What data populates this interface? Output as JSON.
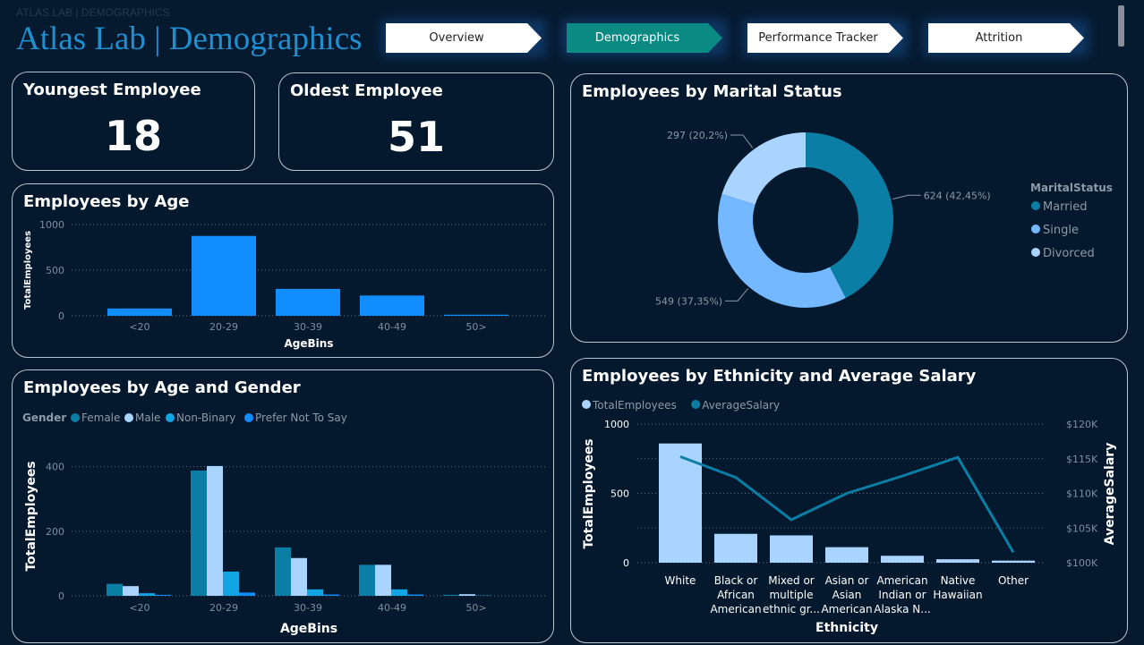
{
  "header": {
    "small_title": "ATLAS LAB | DEMOGRAPHICS",
    "title": "Atlas Lab | Demographics"
  },
  "nav": [
    {
      "label": "Overview",
      "active": false
    },
    {
      "label": "Demographics",
      "active": true
    },
    {
      "label": "Performance Tracker",
      "active": false
    },
    {
      "label": "Attrition",
      "active": false
    }
  ],
  "kpis": {
    "youngest": {
      "label": "Youngest Employee",
      "value": "18"
    },
    "oldest": {
      "label": "Oldest Employee",
      "value": "51"
    }
  },
  "colors": {
    "bright_blue": "#118dff",
    "teal": "#0a7ea4",
    "light_blue": "#a8d4ff",
    "cyan": "#12a5e4",
    "mid_blue": "#74b9ff",
    "background": "#061a2f"
  },
  "chart_data": [
    {
      "id": "age",
      "type": "bar",
      "title": "Employees by Age",
      "xlabel": "AgeBins",
      "ylabel": "TotalEmployees",
      "categories": [
        "<20",
        "20-29",
        "30-39",
        "40-49",
        "50>"
      ],
      "values": [
        80,
        875,
        295,
        222,
        12
      ],
      "ylim": [
        0,
        1000
      ],
      "yticks": [
        0,
        500,
        1000
      ],
      "grid": true
    },
    {
      "id": "age_gender",
      "type": "bar",
      "title": "Employees by Age and Gender",
      "xlabel": "AgeBins",
      "ylabel": "TotalEmployees",
      "legend_title": "Gender",
      "legend_position": "top-left",
      "categories": [
        "<20",
        "20-29",
        "30-39",
        "40-49",
        "50>"
      ],
      "series": [
        {
          "name": "Female",
          "color": "#0a7ea4",
          "values": [
            37,
            388,
            150,
            96,
            3
          ]
        },
        {
          "name": "Male",
          "color": "#a8d4ff",
          "values": [
            30,
            402,
            117,
            96,
            5
          ]
        },
        {
          "name": "Non-Binary",
          "color": "#12a5e4",
          "values": [
            8,
            75,
            20,
            20,
            1
          ]
        },
        {
          "name": "Prefer Not To Say",
          "color": "#118dff",
          "values": [
            3,
            10,
            4,
            4,
            0
          ]
        }
      ],
      "ylim": [
        0,
        460
      ],
      "yticks": [
        0,
        200,
        400
      ],
      "grid": true
    },
    {
      "id": "marital",
      "type": "pie",
      "title": "Employees by Marital Status",
      "legend_title": "MaritalStatus",
      "legend_position": "right",
      "slices": [
        {
          "name": "Married",
          "value": 624,
          "label": "624 (42,45%)",
          "color": "#0a7ea4"
        },
        {
          "name": "Single",
          "value": 549,
          "label": "549 (37,35%)",
          "color": "#74b9ff"
        },
        {
          "name": "Divorced",
          "value": 297,
          "label": "297 (20,2%)",
          "color": "#a8d4ff"
        }
      ]
    },
    {
      "id": "ethnicity",
      "type": "bar",
      "title": "Employees by Ethnicity and Average Salary",
      "xlabel": "Ethnicity",
      "ylabel": "TotalEmployees",
      "y2label": "AverageSalary",
      "legend_position": "top-left",
      "categories": [
        [
          "White"
        ],
        [
          "Black or",
          "African",
          "American"
        ],
        [
          "Mixed or",
          "multiple",
          "ethnic gr..."
        ],
        [
          "Asian or",
          "Asian",
          "American"
        ],
        [
          "American",
          "Indian or",
          "Alaska N..."
        ],
        [
          "Native",
          "Hawaiian"
        ],
        [
          "Other"
        ]
      ],
      "series": [
        {
          "name": "TotalEmployees",
          "type": "bar",
          "color": "#a8d4ff",
          "values": [
            860,
            208,
            197,
            112,
            50,
            25,
            15
          ]
        },
        {
          "name": "AverageSalary",
          "type": "line",
          "color": "#0a7ea4",
          "values": [
            115300,
            112300,
            106200,
            110000,
            112500,
            115200,
            101500
          ]
        }
      ],
      "ylim": [
        0,
        1000
      ],
      "yticks": [
        0,
        500,
        1000
      ],
      "y2lim": [
        100000,
        120000
      ],
      "y2ticks": [
        100000,
        105000,
        110000,
        115000,
        120000
      ],
      "y2ticklabels": [
        "$100K",
        "$105K",
        "$110K",
        "$115K",
        "$120K"
      ],
      "grid": true
    }
  ]
}
